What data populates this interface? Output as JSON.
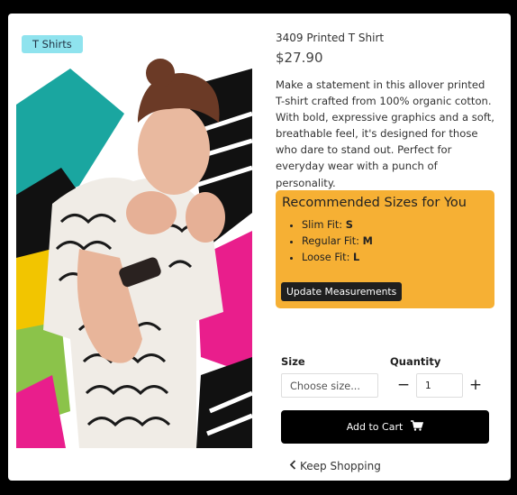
{
  "product": {
    "category_badge": "T Shirts",
    "title": "3409 Printed T Shirt",
    "price": "$27.90",
    "description": "Make a statement in this allover printed T-shirt crafted from 100% organic cotton. With bold, expressive graphics and a soft, breathable feel, it's designed for those who dare to stand out. Perfect for everyday wear with a punch of personality.",
    "image_alt": "Model wearing printed t-shirt"
  },
  "recommendations": {
    "heading": "Recommended Sizes for You",
    "items": [
      {
        "label": "Slim Fit:",
        "value": "S"
      },
      {
        "label": "Regular Fit:",
        "value": "M"
      },
      {
        "label": "Loose Fit:",
        "value": "L"
      }
    ],
    "update_button": "Update Measurements",
    "background": "#f6b034"
  },
  "purchase": {
    "size_label": "Size",
    "size_placeholder": "Choose size...",
    "quantity_label": "Quantity",
    "quantity_value": "1",
    "minus": "−",
    "plus": "+",
    "add_to_cart": "Add to Cart",
    "cart_icon": "cart-icon"
  },
  "footer": {
    "keep_shopping": "Keep Shopping",
    "chevron_icon": "chevron-left-icon"
  },
  "colors": {
    "badge": "#8fe3ee",
    "primary_button": "#000000"
  }
}
